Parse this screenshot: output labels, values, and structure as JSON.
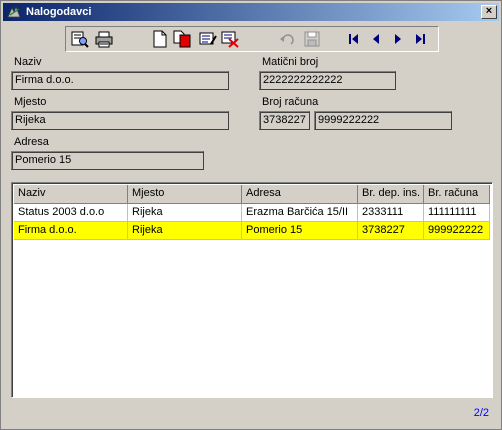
{
  "window": {
    "title": "Nalogodavci",
    "close_label": "×"
  },
  "toolbar": {
    "icons": [
      "search-icon",
      "print-icon",
      "new-document-icon",
      "copy-document-icon",
      "edit-icon",
      "delete-icon",
      "undo-icon",
      "save-icon",
      "first-record-icon",
      "previous-record-icon",
      "next-record-icon",
      "last-record-icon"
    ]
  },
  "form": {
    "naziv": {
      "label": "Naziv",
      "value": "Firma d.o.o."
    },
    "maticni_broj": {
      "label": "Matični broj",
      "value": "2222222222222"
    },
    "mjesto": {
      "label": "Mjesto",
      "value": "Rijeka"
    },
    "broj_racuna": {
      "label": "Broj računa",
      "value_prefix": "3738227",
      "value_account": "9999222222"
    },
    "adresa": {
      "label": "Adresa",
      "value": "Pomerio 15"
    }
  },
  "grid": {
    "columns": [
      "Naziv",
      "Mjesto",
      "Adresa",
      "Br. dep. ins.",
      "Br. računa"
    ],
    "rows": [
      {
        "naziv": "Status 2003 d.o.o",
        "mjesto": "Rijeka",
        "adresa": "Erazma Barčića 15/II",
        "br_dep_ins": "2333111",
        "br_racuna": "111111111",
        "selected": false
      },
      {
        "naziv": "Firma d.o.o.",
        "mjesto": "Rijeka",
        "adresa": "Pomerio 15",
        "br_dep_ins": "3738227",
        "br_racuna": "999922222",
        "selected": true
      }
    ],
    "selected_color": "#ffff00"
  },
  "pager": {
    "text": "2/2"
  },
  "colors": {
    "title_start": "#0a246a",
    "title_end": "#a6caf0",
    "face": "#d4d0c8"
  }
}
